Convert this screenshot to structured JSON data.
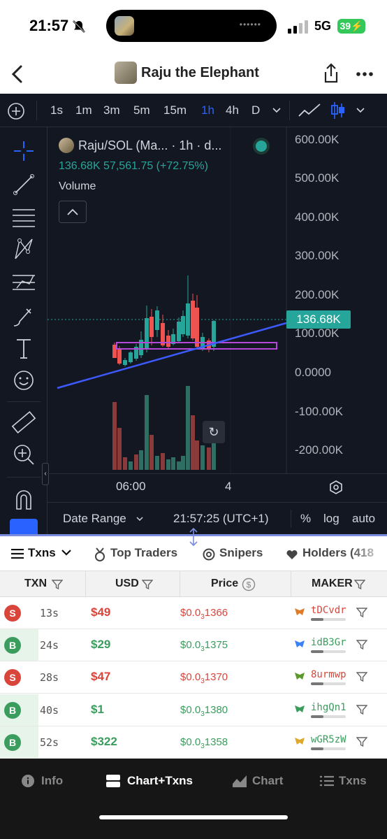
{
  "status": {
    "time": "21:57",
    "network": "5G",
    "battery": "39"
  },
  "nav": {
    "title": "Raju the Elephant"
  },
  "timeframes": [
    "1s",
    "1m",
    "3m",
    "5m",
    "15m",
    "1h",
    "4h",
    "D"
  ],
  "active_timeframe": "1h",
  "legend": {
    "symbol": "Raju/SOL (Ma... · 1h · d...",
    "price_change": "136.68K  57,561.75 (+72.75%)",
    "volume_label": "Volume"
  },
  "y_axis": [
    "600.00K",
    "500.00K",
    "400.00K",
    "300.00K",
    "200.00K",
    "100.00K",
    "0.0000",
    "-100.00K",
    "-200.00K"
  ],
  "current_price": "136.68K",
  "x_axis": [
    "06:00",
    "4"
  ],
  "bottom_bar": {
    "date_range": "Date Range",
    "clock": "21:57:25 (UTC+1)",
    "percent": "%",
    "log": "log",
    "auto": "auto"
  },
  "tabs": [
    "Txns",
    "Top Traders",
    "Snipers",
    "Holders (418"
  ],
  "table_headers": [
    "TXN",
    "USD",
    "Price",
    "MAKER"
  ],
  "rows": [
    {
      "type": "S",
      "age": "13s",
      "usd": "$49",
      "price_a": "$0.0",
      "price_sub": "3",
      "price_b": "1366",
      "maker": "tDCvdr"
    },
    {
      "type": "B",
      "age": "24s",
      "usd": "$29",
      "price_a": "$0.0",
      "price_sub": "3",
      "price_b": "1375",
      "maker": "idB3Gr"
    },
    {
      "type": "S",
      "age": "28s",
      "usd": "$47",
      "price_a": "$0.0",
      "price_sub": "3",
      "price_b": "1370",
      "maker": "8urmwp"
    },
    {
      "type": "B",
      "age": "40s",
      "usd": "$1",
      "price_a": "$0.0",
      "price_sub": "3",
      "price_b": "1380",
      "maker": "ihgQn1"
    },
    {
      "type": "B",
      "age": "52s",
      "usd": "$322",
      "price_a": "$0.0",
      "price_sub": "3",
      "price_b": "1358",
      "maker": "wGR5zW"
    }
  ],
  "bottom_nav": [
    "Info",
    "Chart+Txns",
    "Chart",
    "Txns"
  ],
  "colors": {
    "up": "#26a69a",
    "down": "#ef5350",
    "accent": "#2962ff",
    "sell": "#d9453b",
    "buy": "#3a9d5d"
  }
}
